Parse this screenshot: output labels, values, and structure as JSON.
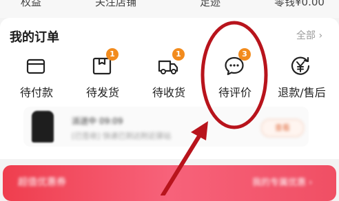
{
  "top_row": [
    "权益",
    "关注店铺",
    "足迹",
    "零钱¥0.00"
  ],
  "order_section": {
    "title": "我的订单",
    "all_link": "全部 ›"
  },
  "order_tiles": [
    {
      "label": "待付款",
      "icon": "wallet-card-icon",
      "badge": ""
    },
    {
      "label": "待发货",
      "icon": "package-box-icon",
      "badge": "1"
    },
    {
      "label": "待收货",
      "icon": "delivery-truck-icon",
      "badge": "1"
    },
    {
      "label": "待评价",
      "icon": "chat-bubble-icon",
      "badge": "3"
    },
    {
      "label": "退款/售后",
      "icon": "refund-yen-icon",
      "badge": ""
    }
  ],
  "preview": {
    "status": "派送中 09:09",
    "detail": "[已签收] 快递已到达附近驿站",
    "action": "查看"
  },
  "banner": {
    "left_text": "超值优惠券",
    "right_text": "我的专属优惠 ›"
  },
  "annotation": {
    "highlight": "待评价",
    "color": "#b8141c"
  }
}
